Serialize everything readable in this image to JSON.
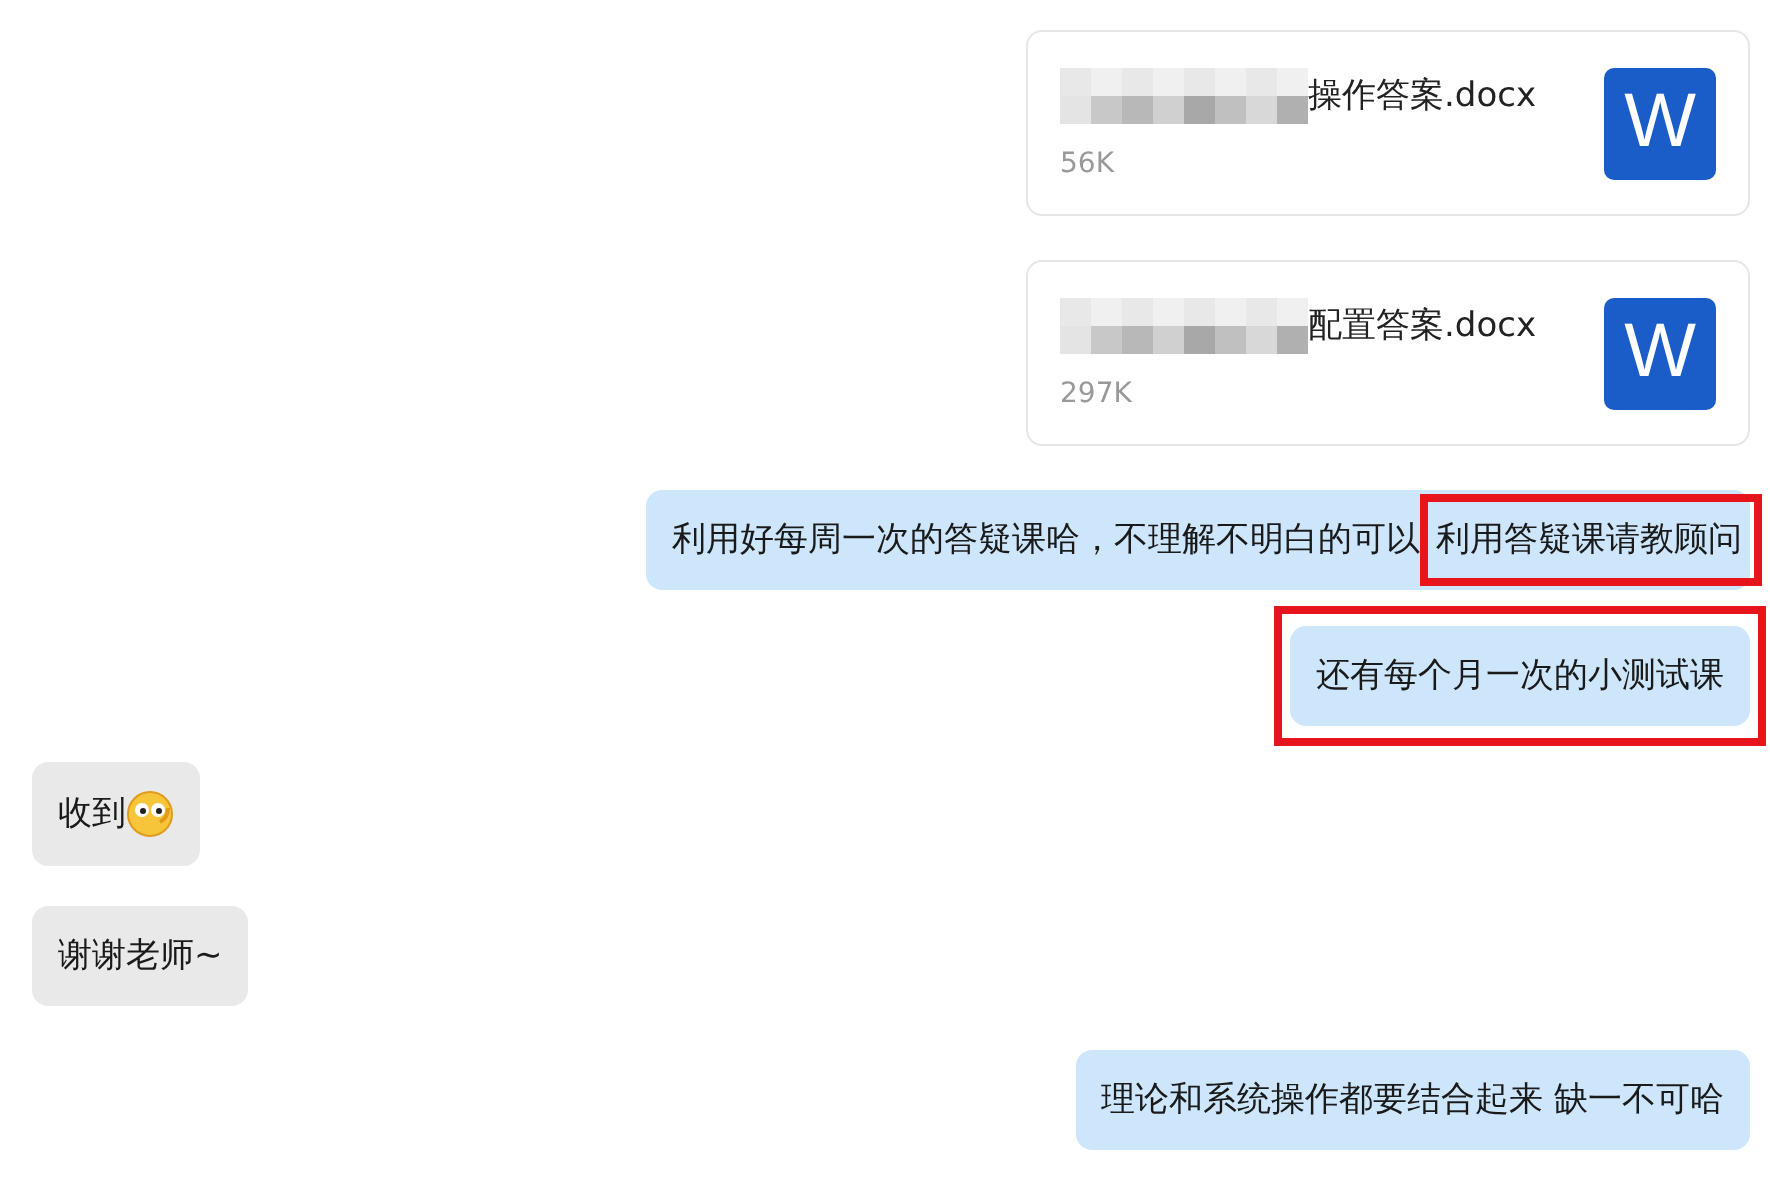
{
  "messages": [
    {
      "kind": "file",
      "outgoing": true,
      "redacted": true,
      "filename": "操作答案.docx",
      "size": "56K",
      "app_icon": "W"
    },
    {
      "kind": "file",
      "outgoing": true,
      "redacted": true,
      "filename": "配置答案.docx",
      "size": "297K",
      "app_icon": "W"
    },
    {
      "kind": "text",
      "outgoing": true,
      "highlighted": false,
      "parts": [
        {
          "text": "利用好每周一次的答疑课哈，不理解不明白的可以",
          "highlighted": false
        },
        {
          "text": "利用答疑课请教顾问",
          "highlighted": true
        }
      ]
    },
    {
      "kind": "text",
      "outgoing": true,
      "highlighted": true,
      "parts": [
        {
          "text": "还有每个月一次的小测试课",
          "highlighted": false
        }
      ]
    },
    {
      "kind": "text",
      "outgoing": false,
      "highlighted": false,
      "emoji": true,
      "parts": [
        {
          "text": "收到",
          "highlighted": false
        }
      ]
    },
    {
      "kind": "text",
      "outgoing": false,
      "highlighted": false,
      "parts": [
        {
          "text": "谢谢老师~",
          "highlighted": false
        }
      ]
    },
    {
      "kind": "text",
      "outgoing": true,
      "highlighted": false,
      "parts": [
        {
          "text": "理论和系统操作都要结合起来 缺一不可哈",
          "highlighted": false
        }
      ]
    }
  ]
}
